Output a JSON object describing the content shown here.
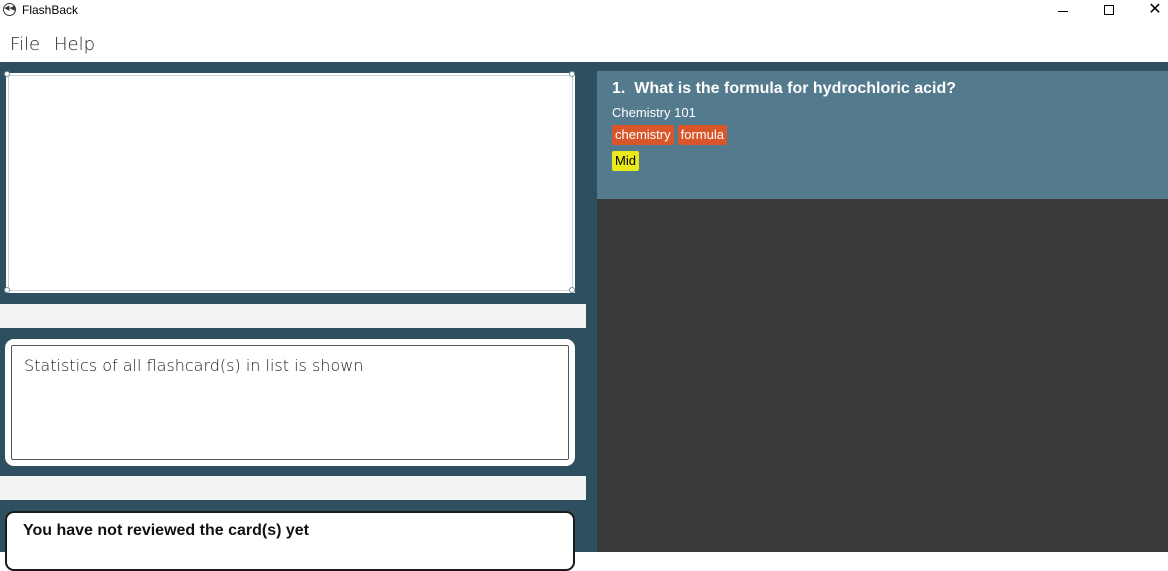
{
  "window": {
    "title": "FlashBack",
    "icon": "rewind-icon",
    "controls": {
      "minimize": "minimize-icon",
      "maximize": "maximize-icon",
      "close": "✕"
    }
  },
  "menu": {
    "file": "File",
    "help": "Help"
  },
  "command": {
    "value": ""
  },
  "result": {
    "text": "Statistics of all flashcard(s) in list is shown"
  },
  "review": {
    "text": "You have not reviewed the card(s) yet"
  },
  "cards": [
    {
      "title": "1.  What is the formula for hydrochloric acid?",
      "category": "Chemistry 101",
      "tags": [
        "chemistry",
        "formula"
      ],
      "difficulty": "Mid"
    }
  ],
  "colors": {
    "panel": "#2e4f5f",
    "card": "#537a8d",
    "list_bg": "#3a3a3a",
    "tag": "#d9562b",
    "difficulty_mid": "#e9e91b"
  }
}
